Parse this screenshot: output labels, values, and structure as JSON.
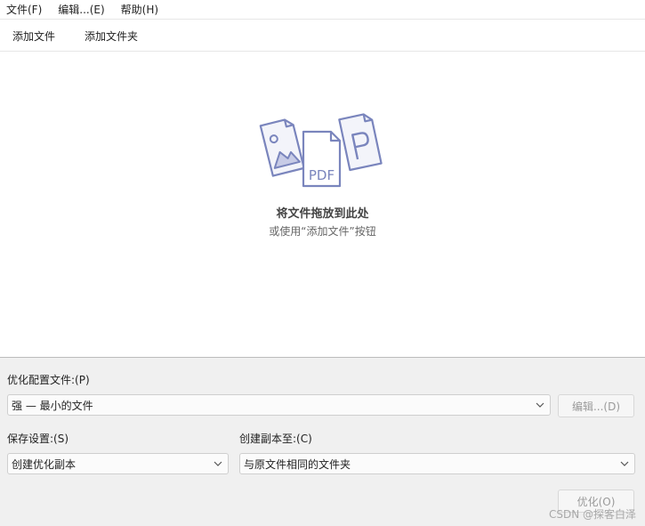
{
  "menu": {
    "file": "文件(F)",
    "edit": "编辑...(E)",
    "help": "帮助(H)"
  },
  "toolbar": {
    "add_file": "添加文件",
    "add_folder": "添加文件夹"
  },
  "dropzone": {
    "title": "将文件拖放到此处",
    "subtitle": "或使用“添加文件”按钮",
    "pdf_text": "PDF",
    "icon_color": "#7a85bd"
  },
  "settings": {
    "profile_label": "优化配置文件:(P)",
    "profile_value": "强 — 最小的文件",
    "edit_button": "编辑...(D)",
    "save_label": "保存设置:(S)",
    "save_value": "创建优化副本",
    "copy_to_label": "创建副本至:(C)",
    "copy_to_value": "与原文件相同的文件夹",
    "optimize_button": "优化(O)"
  },
  "watermark": "CSDN @探客白泽"
}
